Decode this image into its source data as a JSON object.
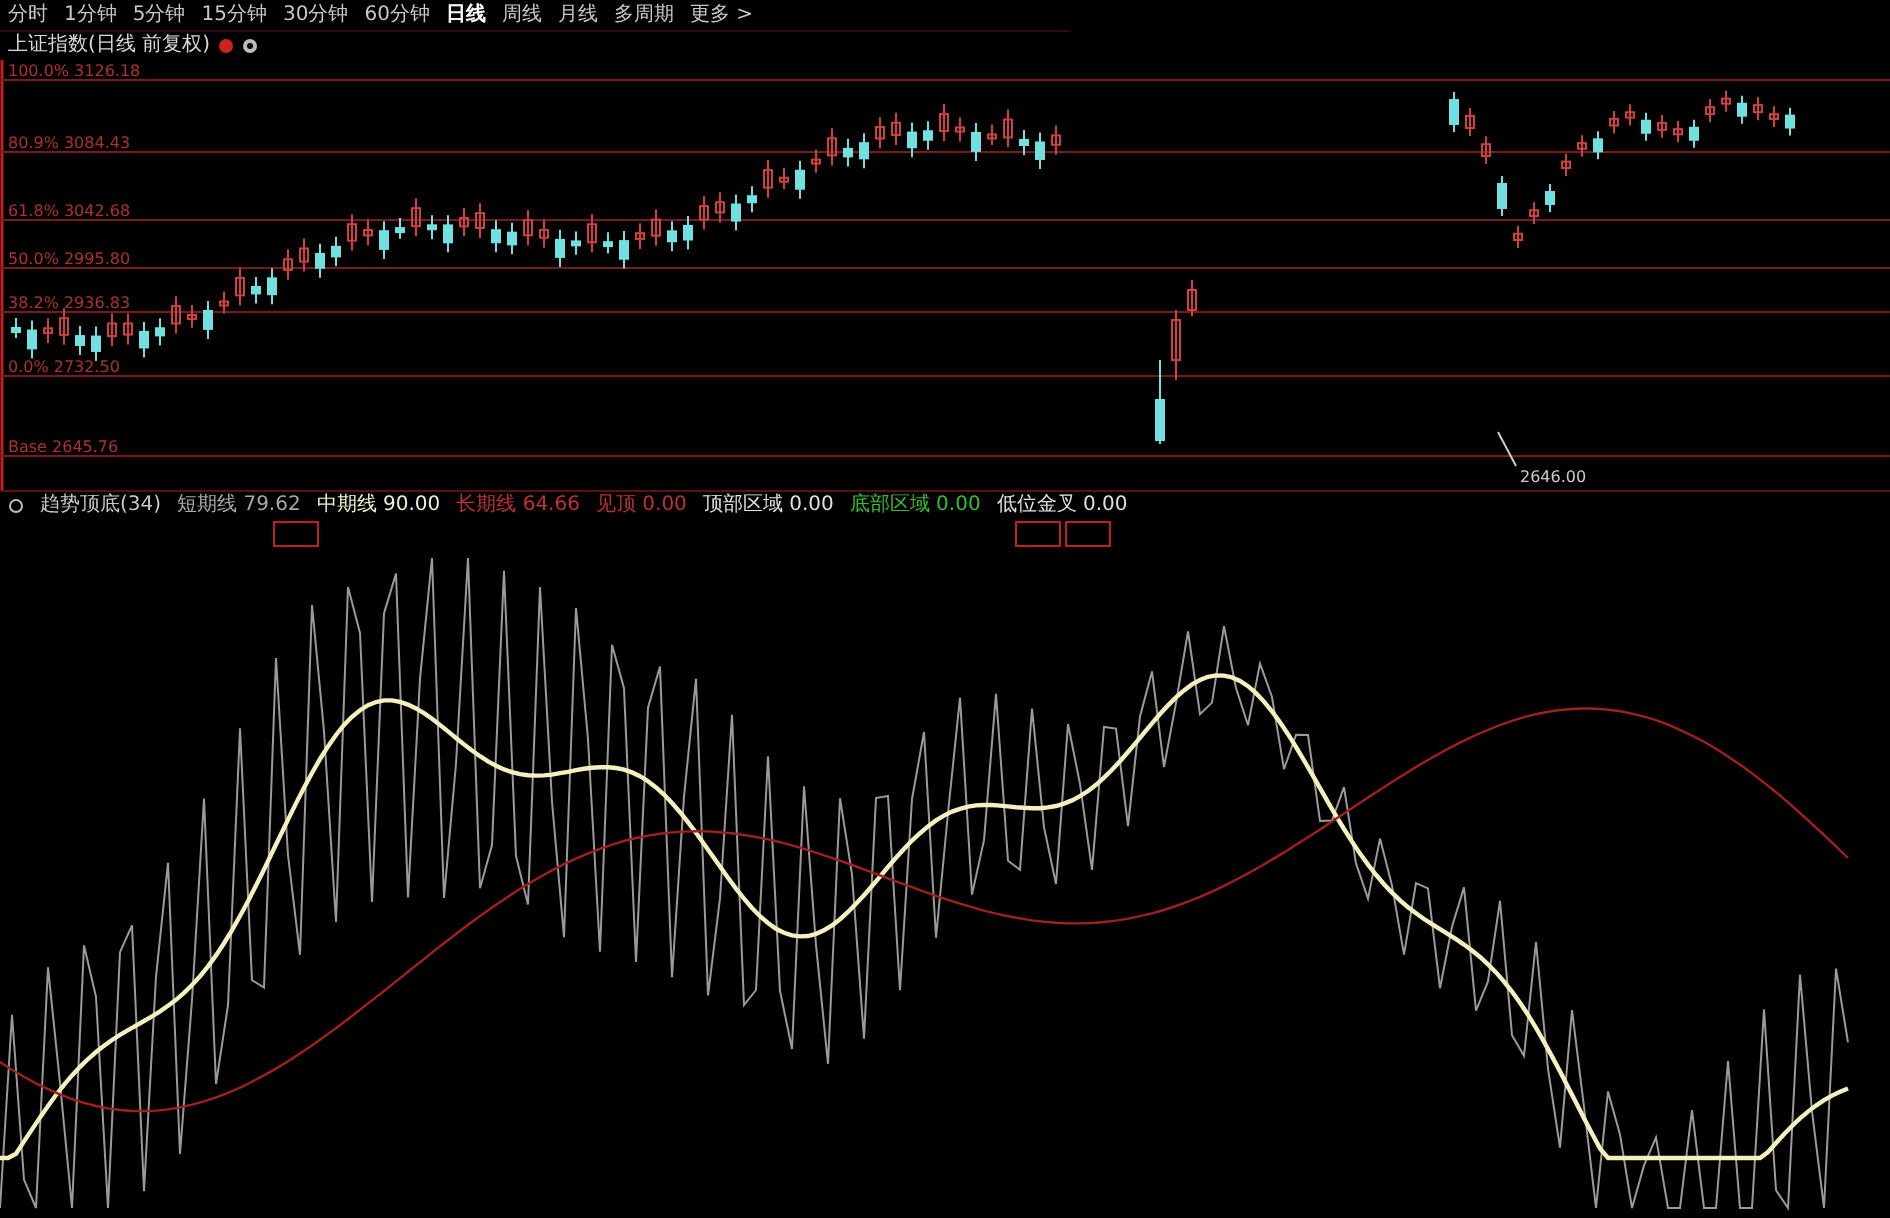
{
  "toolbar": {
    "tabs": [
      {
        "label": "分时",
        "selected": false
      },
      {
        "label": "1分钟",
        "selected": false
      },
      {
        "label": "5分钟",
        "selected": false
      },
      {
        "label": "15分钟",
        "selected": false
      },
      {
        "label": "30分钟",
        "selected": false
      },
      {
        "label": "60分钟",
        "selected": false
      },
      {
        "label": "日线",
        "selected": true
      },
      {
        "label": "周线",
        "selected": false
      },
      {
        "label": "月线",
        "selected": false
      },
      {
        "label": "多周期",
        "selected": false
      },
      {
        "label": "更多 >",
        "selected": false
      }
    ]
  },
  "price_chart": {
    "title": "上证指数(日线 前复权)",
    "levels": [
      "100.0% 3126.18",
      "80.9% 3084.43",
      "61.8% 3042.68",
      "50.0% 2995.80",
      "38.2% 2936.83",
      "0.0% 2732.50",
      "Base 2645.76"
    ],
    "low_label": "2646.00"
  },
  "indicator": {
    "legend": [
      {
        "name": "趋势顶底(34)",
        "color": "#c8c8c8"
      },
      {
        "name": "短期线",
        "value": "79.62",
        "color": "#a8a8a8"
      },
      {
        "name": "中期线",
        "value": "90.00",
        "color": "#f0f0d0"
      },
      {
        "name": "长期线",
        "value": "64.66",
        "color": "#c03030"
      },
      {
        "name": "见顶",
        "value": "0.00",
        "color": "#c03030"
      },
      {
        "name": "顶部区域",
        "value": "0.00",
        "color": "#e0e0e0"
      },
      {
        "name": "底部区域",
        "value": "0.00",
        "color": "#30c030"
      },
      {
        "name": "低位金叉",
        "value": "0.00",
        "color": "#e0e0e0"
      }
    ]
  }
}
